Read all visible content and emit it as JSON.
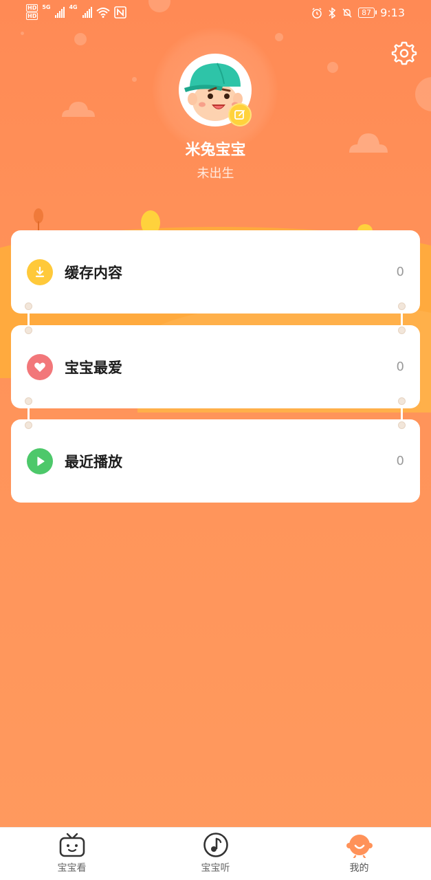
{
  "status_bar": {
    "hd_badges": [
      "HD",
      "HD"
    ],
    "network_labels": [
      "5G",
      "4G"
    ],
    "battery": "87",
    "time": "9:13"
  },
  "profile": {
    "name": "米兔宝宝",
    "status": "未出生"
  },
  "menu": [
    {
      "label": "缓存内容",
      "count": "0",
      "icon": "download-icon",
      "color": "#FFC93A"
    },
    {
      "label": "宝宝最爱",
      "count": "0",
      "icon": "heart-icon",
      "color": "#F2777A"
    },
    {
      "label": "最近播放",
      "count": "0",
      "icon": "play-icon",
      "color": "#4DC86A"
    }
  ],
  "bottom_nav": [
    {
      "label": "宝宝看",
      "icon": "tv-icon"
    },
    {
      "label": "宝宝听",
      "icon": "music-note-icon"
    },
    {
      "label": "我的",
      "icon": "baby-face-icon",
      "active": true
    }
  ],
  "colors": {
    "background": "#FF9259",
    "accent": "#FF8A55"
  }
}
